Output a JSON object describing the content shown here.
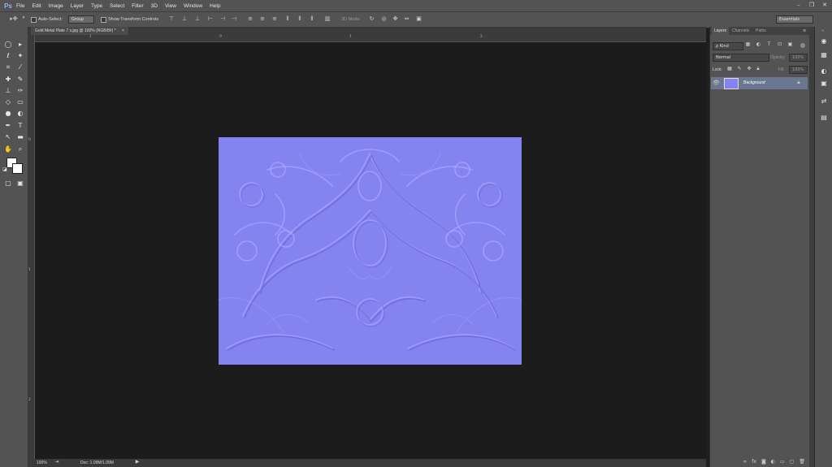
{
  "app": {
    "logo": "Ps"
  },
  "menu": [
    "File",
    "Edit",
    "Image",
    "Layer",
    "Type",
    "Select",
    "Filter",
    "3D",
    "View",
    "Window",
    "Help"
  ],
  "window_controls": {
    "minimize": "–",
    "maximize": "❐",
    "close": "✕"
  },
  "options_bar": {
    "auto_select_label": "Auto-Select:",
    "auto_select_target": "Group",
    "show_transform_label": "Show Transform Controls",
    "three_d_mode_label": "3D Mode:",
    "workspace": "Essentials"
  },
  "document": {
    "tab_title": "Gold Metal Plate 7 s.jpg @ 100% (RGB/8#) *",
    "tab_close": "×",
    "ruler_h": [
      "1",
      "0",
      "1",
      "2"
    ],
    "ruler_v": [
      "0",
      "1",
      "2"
    ],
    "zoom": "100%",
    "doc_info": "Doc: 1.09M/1.09M"
  },
  "panels": {
    "tabs": [
      "Layers",
      "Channels",
      "Paths"
    ],
    "filter_kind": "ρ Kind",
    "blend_mode": "Normal",
    "opacity_label": "Opacity:",
    "opacity_value": "100%",
    "lock_label": "Lock:",
    "fill_label": "Fill:",
    "fill_value": "100%",
    "layers": [
      {
        "name": "Background",
        "locked": true,
        "visible": true
      }
    ],
    "footer_icons": [
      "link-icon",
      "fx-icon",
      "mask-icon",
      "adjustment-icon",
      "group-icon",
      "new-layer-icon",
      "trash-icon"
    ]
  },
  "colors": {
    "ui_dark": "#535353",
    "canvas_bg": "#1c1c1c",
    "artwork_base": "#8583f0",
    "layer_selected": "#6b7790"
  }
}
